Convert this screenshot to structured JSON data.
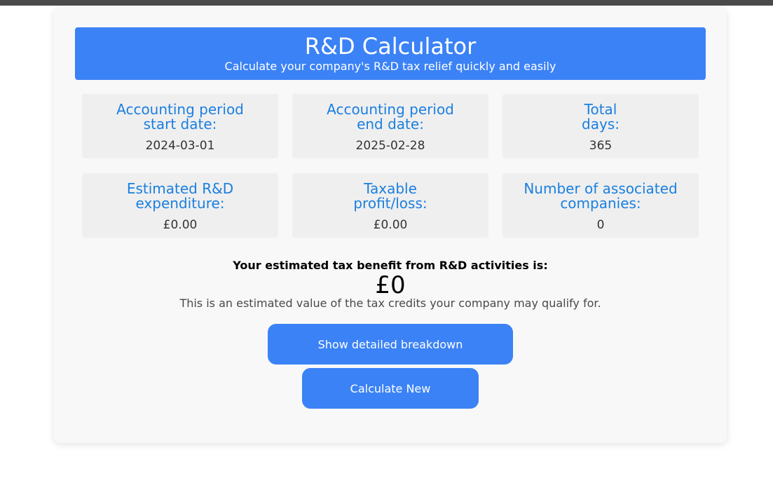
{
  "header": {
    "title": "R&D Calculator",
    "subtitle": "Calculate your company's R&D tax relief quickly and easily"
  },
  "fields": {
    "start_date": {
      "label": "Accounting period\nstart date:",
      "value": "2024-03-01"
    },
    "end_date": {
      "label": "Accounting period\nend date:",
      "value": "2025-02-28"
    },
    "total_days": {
      "label": "Total\ndays:",
      "value": "365"
    },
    "rd_expenditure": {
      "label": "Estimated R&D\nexpenditure:",
      "value": "£0.00"
    },
    "taxable_profit": {
      "label": "Taxable\nprofit/loss:",
      "value": "£0.00"
    },
    "associated_companies": {
      "label": "Number of associated\ncompanies:",
      "value": "0"
    }
  },
  "result": {
    "heading": "Your estimated tax benefit from R&D activities is:",
    "amount": "£0",
    "note": "This is an estimated value of the tax credits your company may qualify for."
  },
  "buttons": {
    "breakdown_label": "Show detailed breakdown",
    "new_label": "Calculate New"
  },
  "colors": {
    "accent": "#3b82f6",
    "label": "#1a7fe0",
    "box_bg": "#efefef"
  }
}
